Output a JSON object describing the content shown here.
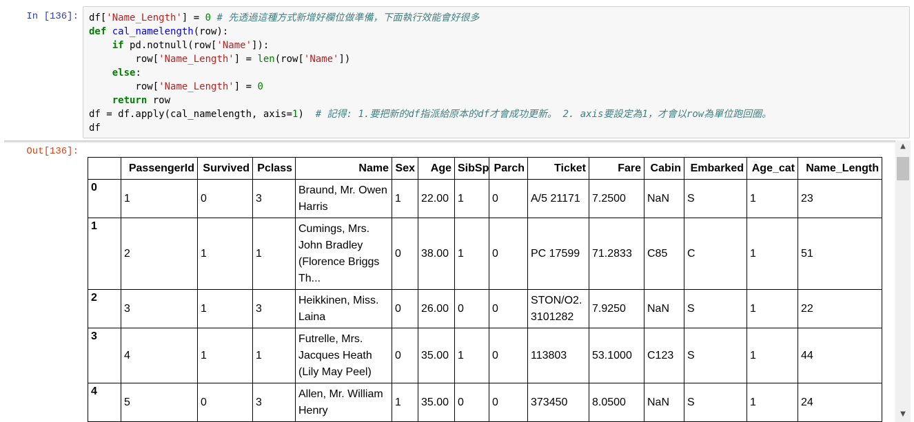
{
  "cell": {
    "in_prompt": "In [136]:",
    "out_prompt": "Out[136]:",
    "code_lines": [
      [
        [
          "t",
          "df["
        ],
        [
          "s",
          "'Name_Length'"
        ],
        [
          "t",
          "] = "
        ],
        [
          "n",
          "0"
        ],
        [
          "t",
          " "
        ],
        [
          "c",
          "# 先透過這種方式新增好欄位做準備，下面執行效能會好很多"
        ]
      ],
      [
        [
          "k",
          "def"
        ],
        [
          "t",
          " "
        ],
        [
          "f",
          "cal_namelength"
        ],
        [
          "t",
          "(row):"
        ]
      ],
      [
        [
          "t",
          "    "
        ],
        [
          "k",
          "if"
        ],
        [
          "t",
          " pd.notnull(row["
        ],
        [
          "s",
          "'Name'"
        ],
        [
          "t",
          "]):"
        ]
      ],
      [
        [
          "t",
          "        row["
        ],
        [
          "s",
          "'Name_Length'"
        ],
        [
          "t",
          "] = "
        ],
        [
          "b",
          "len"
        ],
        [
          "t",
          "(row["
        ],
        [
          "s",
          "'Name'"
        ],
        [
          "t",
          "])"
        ]
      ],
      [
        [
          "t",
          "    "
        ],
        [
          "k",
          "else"
        ],
        [
          "t",
          ":"
        ]
      ],
      [
        [
          "t",
          "        row["
        ],
        [
          "s",
          "'Name_Length'"
        ],
        [
          "t",
          "] = "
        ],
        [
          "n",
          "0"
        ]
      ],
      [
        [
          "t",
          "    "
        ],
        [
          "k",
          "return"
        ],
        [
          "t",
          " row"
        ]
      ],
      [
        [
          "t",
          "df = df.apply(cal_namelength, axis="
        ],
        [
          "n",
          "1"
        ],
        [
          "t",
          ")  "
        ],
        [
          "c",
          "# 記得: 1.要把新的df指派給原本的df才會成功更新。 2. axis要設定為1，才會以row為單位跑回圈。"
        ]
      ],
      [
        [
          "t",
          "df"
        ]
      ]
    ]
  },
  "dataframe": {
    "columns": [
      "",
      "PassengerId",
      "Survived",
      "Pclass",
      "Name",
      "Sex",
      "Age",
      "SibSp",
      "Parch",
      "Ticket",
      "Fare",
      "Cabin",
      "Embarked",
      "Age_cat",
      "Name_Length"
    ],
    "rows": [
      {
        "index": "0",
        "cells": [
          "1",
          "0",
          "3",
          "Braund, Mr. Owen Harris",
          "1",
          "22.00",
          "1",
          "0",
          "A/5 21171",
          "7.2500",
          "NaN",
          "S",
          "1",
          "23"
        ]
      },
      {
        "index": "1",
        "cells": [
          "2",
          "1",
          "1",
          "Cumings, Mrs. John Bradley (Florence Briggs Th...",
          "0",
          "38.00",
          "1",
          "0",
          "PC 17599",
          "71.2833",
          "C85",
          "C",
          "1",
          "51"
        ]
      },
      {
        "index": "2",
        "cells": [
          "3",
          "1",
          "3",
          "Heikkinen, Miss. Laina",
          "0",
          "26.00",
          "0",
          "0",
          "STON/O2. 3101282",
          "7.9250",
          "NaN",
          "S",
          "1",
          "22"
        ]
      },
      {
        "index": "3",
        "cells": [
          "4",
          "1",
          "1",
          "Futrelle, Mrs. Jacques Heath (Lily May Peel)",
          "0",
          "35.00",
          "1",
          "0",
          "113803",
          "53.1000",
          "C123",
          "S",
          "1",
          "44"
        ]
      },
      {
        "index": "4",
        "cells": [
          "5",
          "0",
          "3",
          "Allen, Mr. William Henry",
          "1",
          "35.00",
          "0",
          "0",
          "373450",
          "8.0500",
          "NaN",
          "S",
          "1",
          "24"
        ]
      }
    ]
  },
  "scrollbar": {
    "up_icon": "triangle-up-icon",
    "down_icon": "triangle-down-icon"
  },
  "colors": {
    "in_prompt": "#303f9f",
    "out_prompt": "#d84315",
    "keyword": "#008000",
    "string": "#ba2121",
    "comment": "#408080",
    "function": "#0000ff"
  }
}
